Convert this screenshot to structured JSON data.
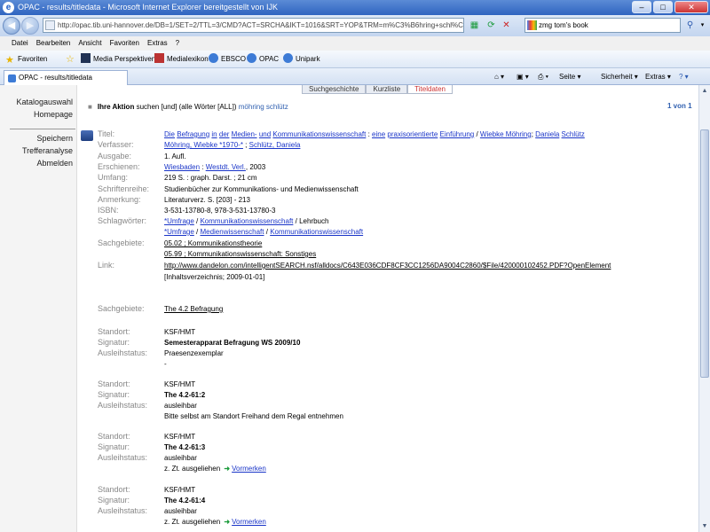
{
  "window": {
    "title": "OPAC - results/titledata - Microsoft Internet Explorer bereitgestellt von IJK",
    "minimize": "–",
    "maximize": "□",
    "close": "✕"
  },
  "address": {
    "url": "http://opac.tib.uni-hannover.de/DB=1/SET=2/TTL=3/CMD?ACT=SRCHA&IKT=1016&SRT=YOP&TRM=m%C3%B6hring+schl%C3%BC"
  },
  "search": {
    "value": "zmg tom's book"
  },
  "menu": {
    "items": [
      "Datei",
      "Bearbeiten",
      "Ansicht",
      "Favoriten",
      "Extras",
      "?"
    ]
  },
  "favorites": {
    "button": "Favoriten",
    "links": [
      "Media Perspektiven",
      "Medialexikon",
      "EBSCO",
      "OPAC",
      "Unipark"
    ]
  },
  "tabbar": {
    "tab_title": "OPAC - results/titledata",
    "commands": [
      "Seite ▾",
      "Sicherheit ▾",
      "Extras ▾"
    ]
  },
  "sidebar": {
    "links": [
      "Katalogauswahl",
      "Homepage",
      "Speichern",
      "Trefferanalyse",
      "Abmelden"
    ]
  },
  "viewtabs": [
    "Suchgeschichte",
    "Kurzliste",
    "Titeldaten"
  ],
  "action": {
    "label": "Ihre Aktion",
    "text": "suchen [und] (alle Wörter [ALL])",
    "query": "möhring schlütz"
  },
  "pager": "1 von 1",
  "record": {
    "labels": {
      "titel": "Titel:",
      "verfasser": "Verfasser:",
      "ausgabe": "Ausgabe:",
      "erschienen": "Erschienen:",
      "umfang": "Umfang:",
      "schriftenreihe": "Schriftenreihe:",
      "anmerkung": "Anmerkung:",
      "isbn": "ISBN:",
      "schlagwoerter": "Schlagwörter:",
      "sachgebiete": "Sachgebiete:",
      "link": "Link:",
      "sachgebiete2": "Sachgebiete:"
    },
    "titel": {
      "w1": "Die",
      "w2": "Befragung",
      "w3": "in",
      "w4": "der",
      "w5": "Medien-",
      "w6": "und",
      "w7": "Kommunikationswissenschaft",
      "sep": " : ",
      "w8": "eine",
      "w9": "praxisorientierte",
      "w10": "Einführung",
      "slash": " / ",
      "w11": "Wiebke Möhring",
      "semi": "; ",
      "w12": "Daniela",
      "w13": "Schlütz"
    },
    "verfasser": {
      "a1": "Möhring, Wiebke *1970-*",
      "sep": " ; ",
      "a2": "Schlütz, Daniela"
    },
    "ausgabe": "1. Aufl.",
    "erschienen": {
      "place": "Wiesbaden",
      "sep": " : ",
      "publisher": "Westdt. Verl.",
      "year": ", 2003"
    },
    "umfang": "219 S. : graph. Darst. ; 21 cm",
    "schriftenreihe": "Studienbücher zur Kommunikations- und Medienwissenschaft",
    "anmerkung": "Literaturverz. S. [203] - 213",
    "isbn": "3-531-13780-8, 978-3-531-13780-3",
    "schlagwoerter": {
      "line1_s1": "*Umfrage",
      "line1_sep": " / ",
      "line1_s2": "Kommunikationswissenschaft",
      "line1_tail": " / Lehrbuch",
      "line2_s1": "*Umfrage",
      "line2_sep1": " / ",
      "line2_s2": "Medienwissenschaft",
      "line2_sep2": " / ",
      "line2_s3": "Kommunikationswissenschaft"
    },
    "sachgebiete": [
      "05.02 ; Kommunikationstheorie",
      "05.99 ; Kommunikationswissenschaft: Sonstiges"
    ],
    "link": {
      "url": "http://www.dandelon.com/intelligentSEARCH.nsf/alldocs/C643E036CDF8CF3CC1256DA9004C2860/$File/420000102452.PDF?OpenElement",
      "note": "[Inhaltsverzeichnis; 2009-01-01]"
    },
    "sachgebiete2": "The 4.2 Befragung"
  },
  "holdings_labels": {
    "standort": "Standort:",
    "signatur": "Signatur:",
    "ausleihstatus": "Ausleihstatus:"
  },
  "holdings": [
    {
      "standort": "KSF/HMT",
      "signatur": "Semesterapparat Befragung WS 2009/10",
      "status": "Praesenzexemplar",
      "note": "-"
    },
    {
      "standort": "KSF/HMT",
      "signatur": "The 4.2-61:2",
      "status": "ausleihbar",
      "note": "Bitte selbst am Standort Freihand dem Regal entnehmen"
    },
    {
      "standort": "KSF/HMT",
      "signatur": "The 4.2-61:3",
      "status": "ausleihbar",
      "note": "z. Zt. ausgeliehen",
      "reserve": "Vormerken"
    },
    {
      "standort": "KSF/HMT",
      "signatur": "The 4.2-61:4",
      "status": "ausleihbar",
      "note": "z. Zt. ausgeliehen",
      "reserve": "Vormerken"
    }
  ],
  "icons": [
    "ie-logo-icon",
    "back-icon",
    "forward-icon",
    "refresh-icon",
    "stop-icon",
    "google-icon",
    "search-icon",
    "star-icon",
    "book-icon",
    "reserve-arrow-icon"
  ]
}
